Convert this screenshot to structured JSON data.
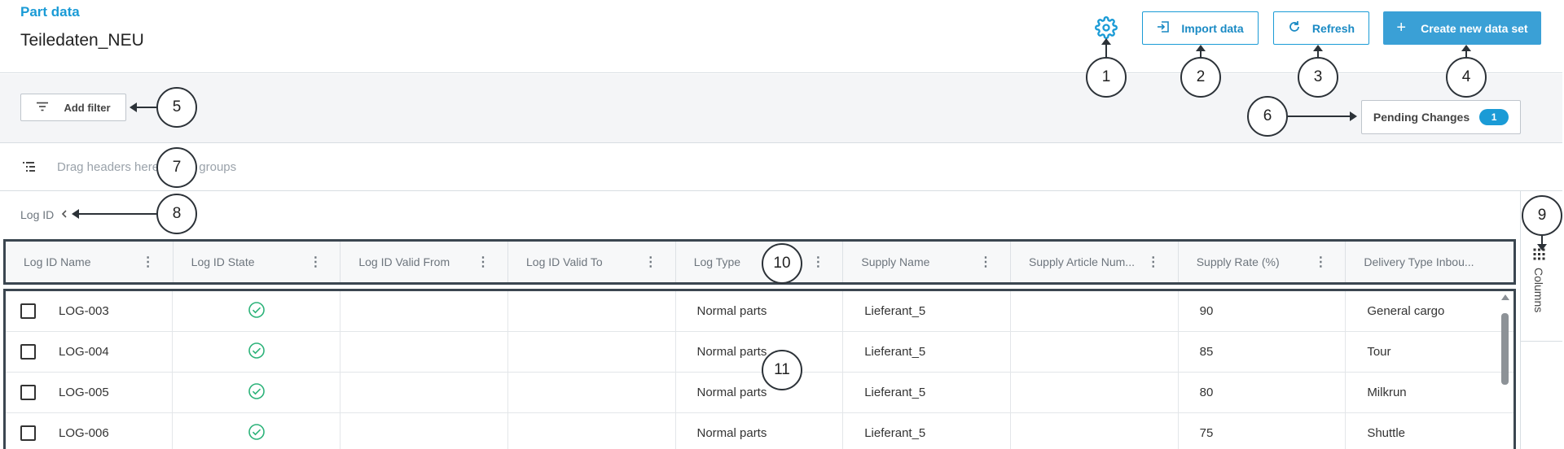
{
  "header": {
    "breadcrumb": "Part data",
    "title": "Teiledaten_NEU",
    "settings_icon": "gear-icon",
    "import_label": "Import data",
    "refresh_label": "Refresh",
    "create_label": "Create new data set",
    "accent_color": "#1a9bd6"
  },
  "filterbar": {
    "add_filter_label": "Add filter",
    "pending_label": "Pending Changes",
    "pending_count": "1"
  },
  "groupbar": {
    "placeholder": "Drag headers here to row groups"
  },
  "rowgroup": {
    "label": "Log ID"
  },
  "sidebar": {
    "columns_label": "Columns"
  },
  "grid": {
    "columns": [
      "Log ID Name",
      "Log ID State",
      "Log ID Valid From",
      "Log ID Valid To",
      "Log Type",
      "Supply Name",
      "Supply Article Num...",
      "Supply Rate (%)",
      "Delivery Type Inbou..."
    ],
    "rows": [
      {
        "name": "LOG-003",
        "state": "valid",
        "valid_from": "",
        "valid_to": "",
        "log_type": "Normal parts",
        "supply_name": "Lieferant_5",
        "article_num": "",
        "rate": "90",
        "delivery": "General cargo"
      },
      {
        "name": "LOG-004",
        "state": "valid",
        "valid_from": "",
        "valid_to": "",
        "log_type": "Normal parts",
        "supply_name": "Lieferant_5",
        "article_num": "",
        "rate": "85",
        "delivery": "Tour"
      },
      {
        "name": "LOG-005",
        "state": "valid",
        "valid_from": "",
        "valid_to": "",
        "log_type": "Normal parts",
        "supply_name": "Lieferant_5",
        "article_num": "",
        "rate": "80",
        "delivery": "Milkrun"
      },
      {
        "name": "LOG-006",
        "state": "valid",
        "valid_from": "",
        "valid_to": "",
        "log_type": "Normal parts",
        "supply_name": "Lieferant_5",
        "article_num": "",
        "rate": "75",
        "delivery": "Shuttle"
      }
    ],
    "state_icon_color": "#2db37a"
  },
  "callouts": [
    "1",
    "2",
    "3",
    "4",
    "5",
    "6",
    "7",
    "8",
    "9",
    "10",
    "11"
  ]
}
